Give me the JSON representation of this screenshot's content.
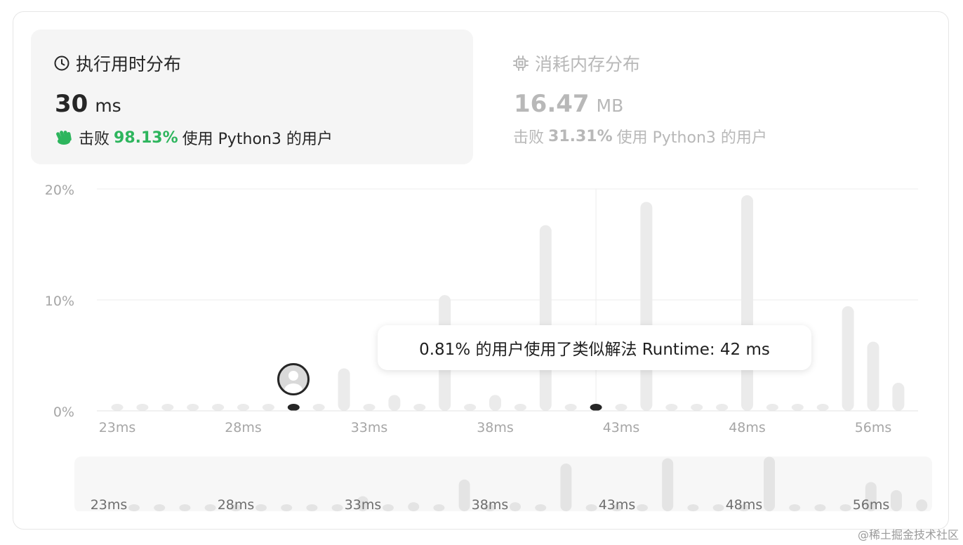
{
  "runtime_tab": {
    "title": "执行用时分布",
    "value": "30",
    "unit": "ms",
    "beats_prefix": "击败",
    "beats_pct": "98.13%",
    "beats_suffix": "使用 Python3 的用户",
    "icon": "clock-icon",
    "beats_icon": "clap-icon"
  },
  "memory_tab": {
    "title": "消耗内存分布",
    "value": "16.47",
    "unit": "MB",
    "beats_prefix": "击败",
    "beats_pct": "31.31%",
    "beats_suffix": "使用 Python3 的用户",
    "icon": "chip-icon"
  },
  "tooltip": {
    "text": "0.81% 的用户使用了类似解法 Runtime: 42 ms"
  },
  "watermark": "@稀土掘金技术社区",
  "colors": {
    "accent_green": "#2db55d",
    "bar": "#ebebeb",
    "selected": "#262626"
  },
  "chart_data": {
    "type": "bar",
    "y_ticks": [
      "20%",
      "10%",
      "0%"
    ],
    "ylim": [
      0,
      20
    ],
    "x_tick_labels": [
      "23ms",
      "28ms",
      "33ms",
      "38ms",
      "43ms",
      "48ms",
      "56ms"
    ],
    "x_tick_indices": [
      0,
      5,
      10,
      15,
      20,
      25,
      30
    ],
    "values": [
      0,
      0,
      0,
      0,
      0,
      0,
      0,
      0,
      0,
      3.2,
      0,
      0.8,
      0,
      9.8,
      0,
      0.8,
      0,
      16.1,
      0,
      0,
      0,
      18.2,
      0,
      0,
      0,
      18.8,
      0,
      0,
      0,
      8.8,
      5.6,
      1.9
    ],
    "your_runtime_index": 7,
    "selected_index": 19,
    "grid": true
  }
}
